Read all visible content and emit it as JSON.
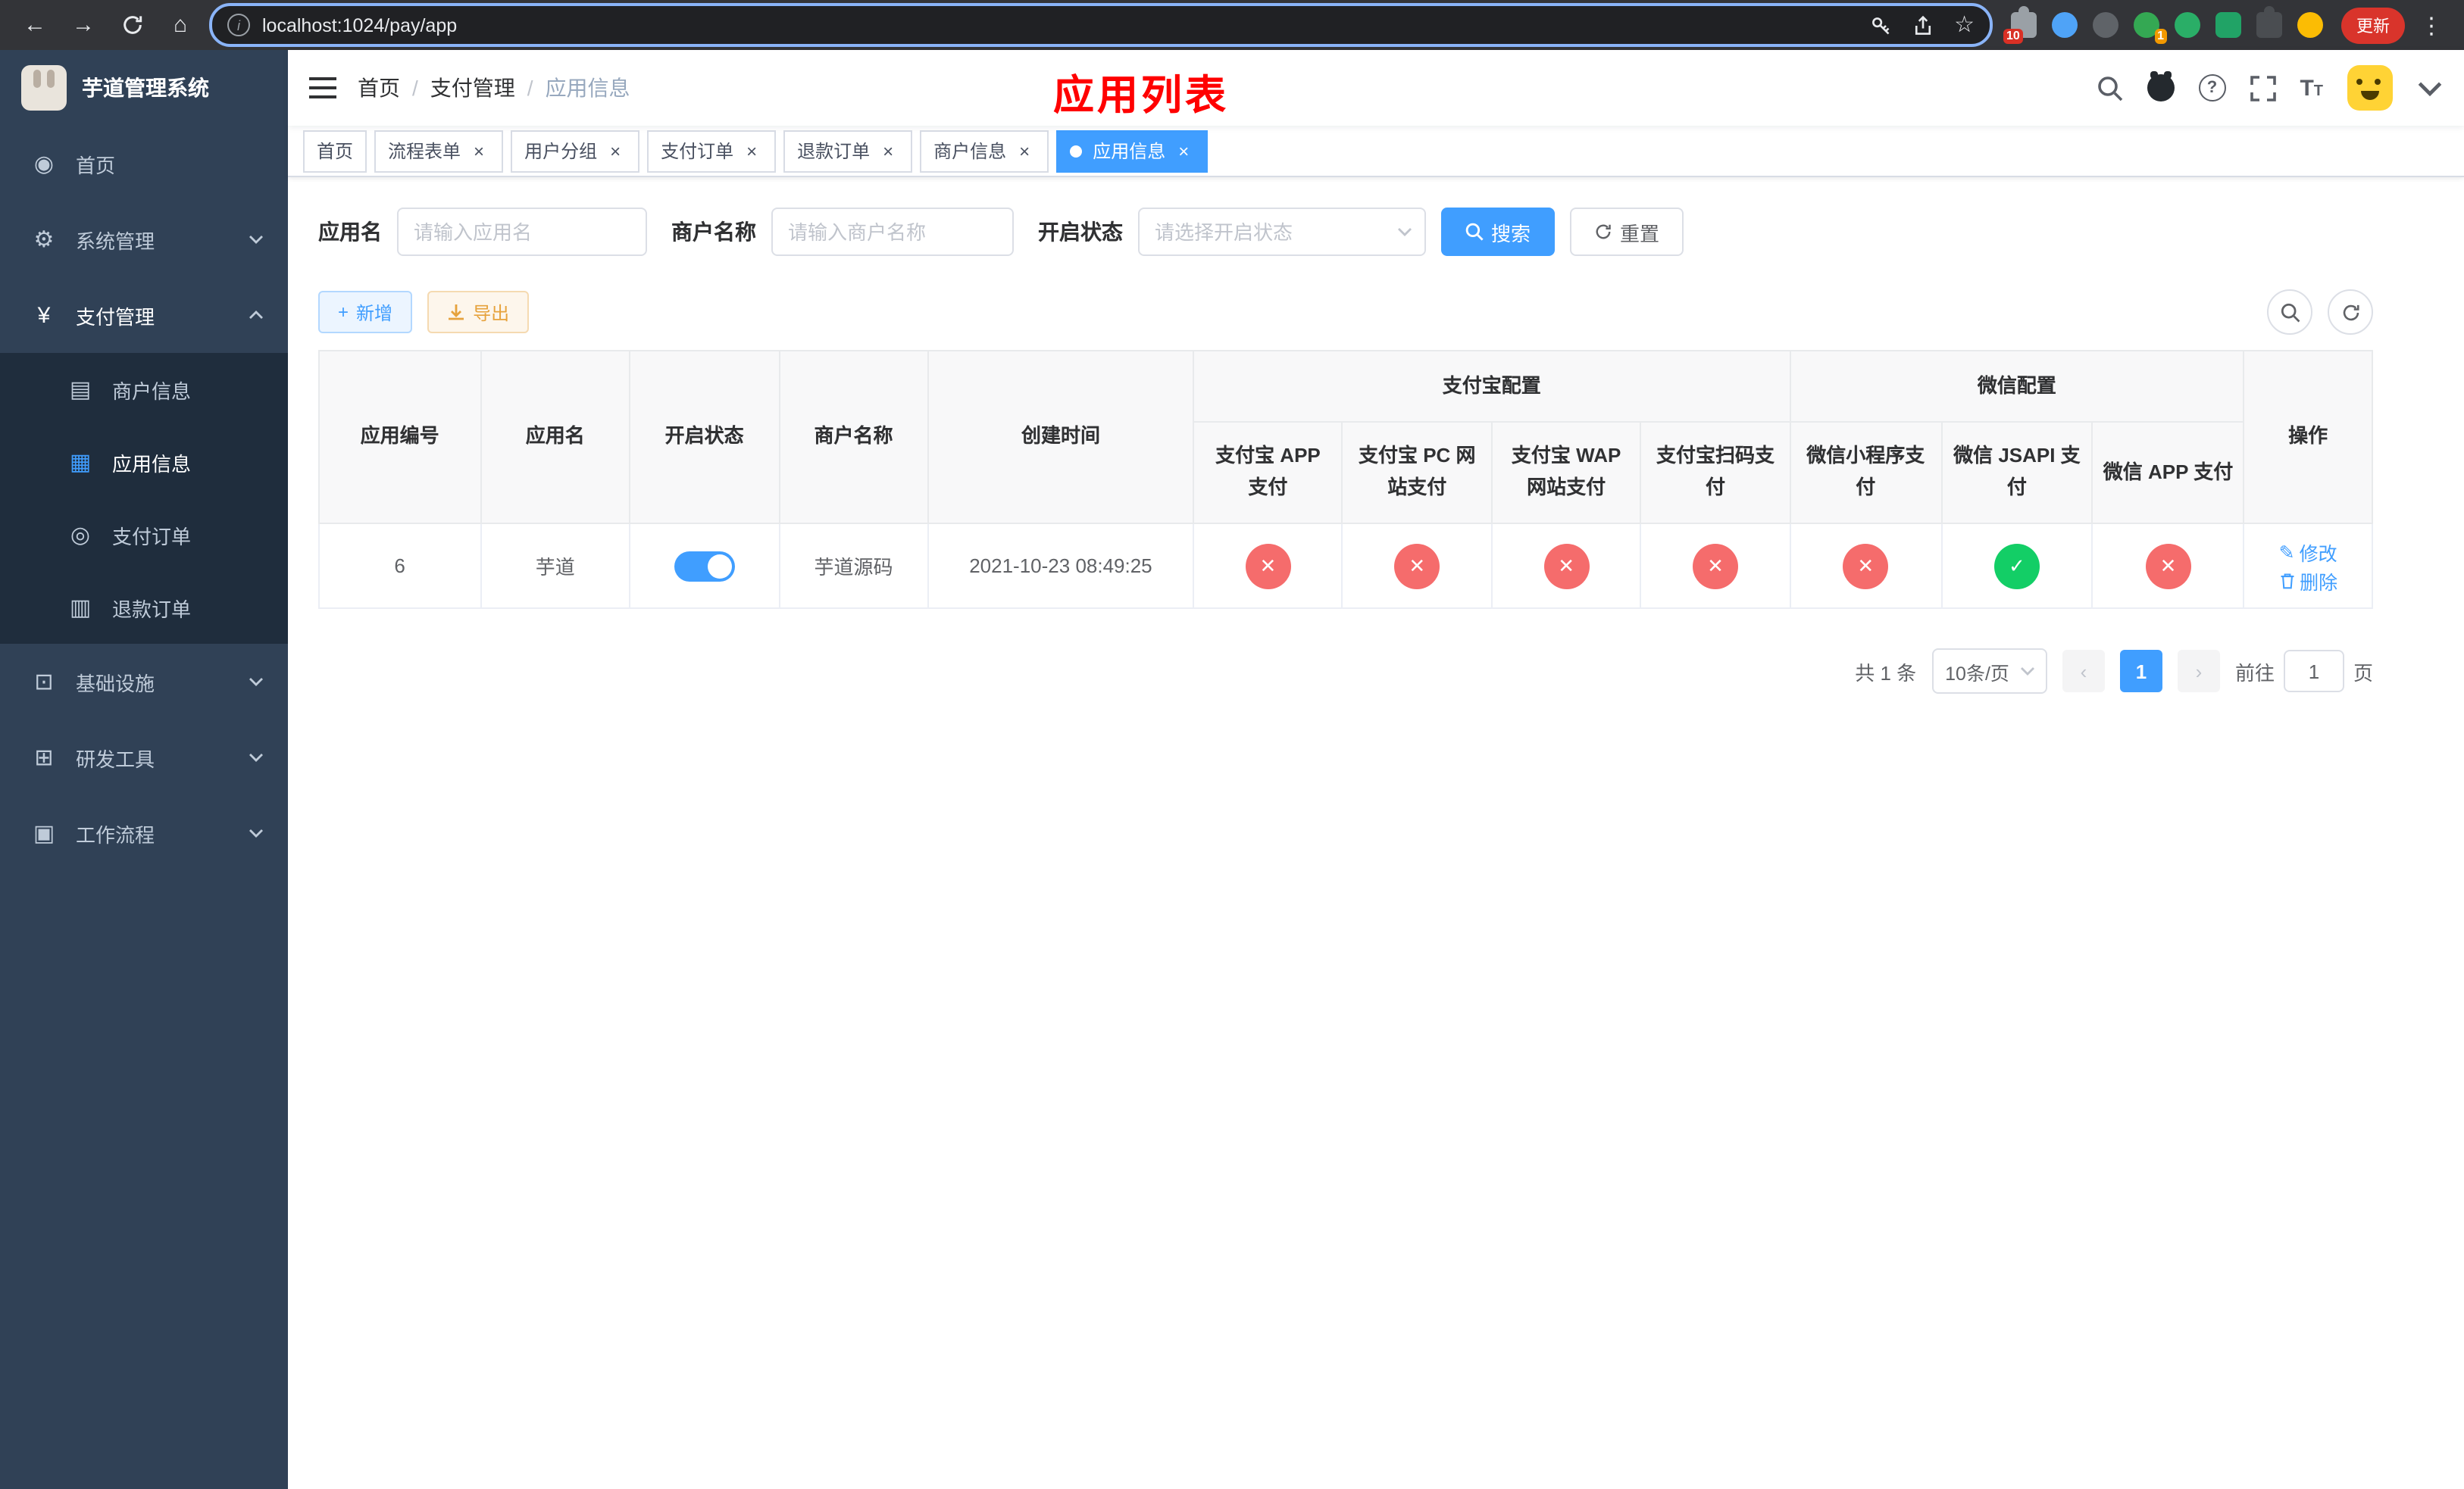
{
  "browser": {
    "url": "localhost:1024/pay/app",
    "update_label": "更新",
    "puzzle_badge": "10",
    "avatar_badge": "1"
  },
  "sidebar": {
    "logo_title": "芋道管理系统",
    "items": [
      {
        "label": "首页"
      },
      {
        "label": "系统管理"
      },
      {
        "label": "支付管理"
      },
      {
        "label": "基础设施"
      },
      {
        "label": "研发工具"
      },
      {
        "label": "工作流程"
      }
    ],
    "pay_children": [
      {
        "label": "商户信息"
      },
      {
        "label": "应用信息"
      },
      {
        "label": "支付订单"
      },
      {
        "label": "退款订单"
      }
    ]
  },
  "navbar": {
    "breadcrumb": [
      "首页",
      "支付管理",
      "应用信息"
    ],
    "annotation": "应用列表",
    "annotation_color": "#ff0000"
  },
  "tabs": [
    {
      "label": "首页",
      "closable": false,
      "active": false
    },
    {
      "label": "流程表单",
      "closable": true,
      "active": false
    },
    {
      "label": "用户分组",
      "closable": true,
      "active": false
    },
    {
      "label": "支付订单",
      "closable": true,
      "active": false
    },
    {
      "label": "退款订单",
      "closable": true,
      "active": false
    },
    {
      "label": "商户信息",
      "closable": true,
      "active": false
    },
    {
      "label": "应用信息",
      "closable": true,
      "active": true
    }
  ],
  "filters": {
    "app_name_label": "应用名",
    "app_name_placeholder": "请输入应用名",
    "merchant_label": "商户名称",
    "merchant_placeholder": "请输入商户名称",
    "status_label": "开启状态",
    "status_placeholder": "请选择开启状态",
    "search_label": "搜索",
    "reset_label": "重置"
  },
  "toolbar": {
    "add_label": "新增",
    "export_label": "导出"
  },
  "table": {
    "headers": [
      "应用编号",
      "应用名",
      "开启状态",
      "商户名称",
      "创建时间"
    ],
    "groups": [
      {
        "label": "支付宝配置",
        "children": [
          "支付宝 APP 支付",
          "支付宝 PC 网站支付",
          "支付宝 WAP 网站支付",
          "支付宝扫码支付"
        ]
      },
      {
        "label": "微信配置",
        "children": [
          "微信小程序支付",
          "微信 JSAPI 支付",
          "微信 APP 支付"
        ]
      }
    ],
    "action_header": "操作",
    "rows": [
      {
        "id": "6",
        "name": "芋道",
        "enabled": true,
        "merchant": "芋道源码",
        "created_at": "2021-10-23 08:49:25",
        "configs": [
          "no",
          "no",
          "no",
          "no",
          "no",
          "yes",
          "no"
        ],
        "edit_label": "修改",
        "delete_label": "删除"
      }
    ],
    "status_colors": {
      "yes": "#13ce66",
      "no": "#f56c6c"
    }
  },
  "pagination": {
    "total_label": "共 1 条",
    "page_size_label": "10条/页",
    "current_page": "1",
    "goto_prefix": "前往",
    "goto_value": "1",
    "goto_suffix": "页"
  },
  "theme": {
    "accent": "#409eff",
    "sidebar_bg": "#304156",
    "submenu_bg": "#1f2d3d",
    "active_tab_bg": "#409eff"
  }
}
